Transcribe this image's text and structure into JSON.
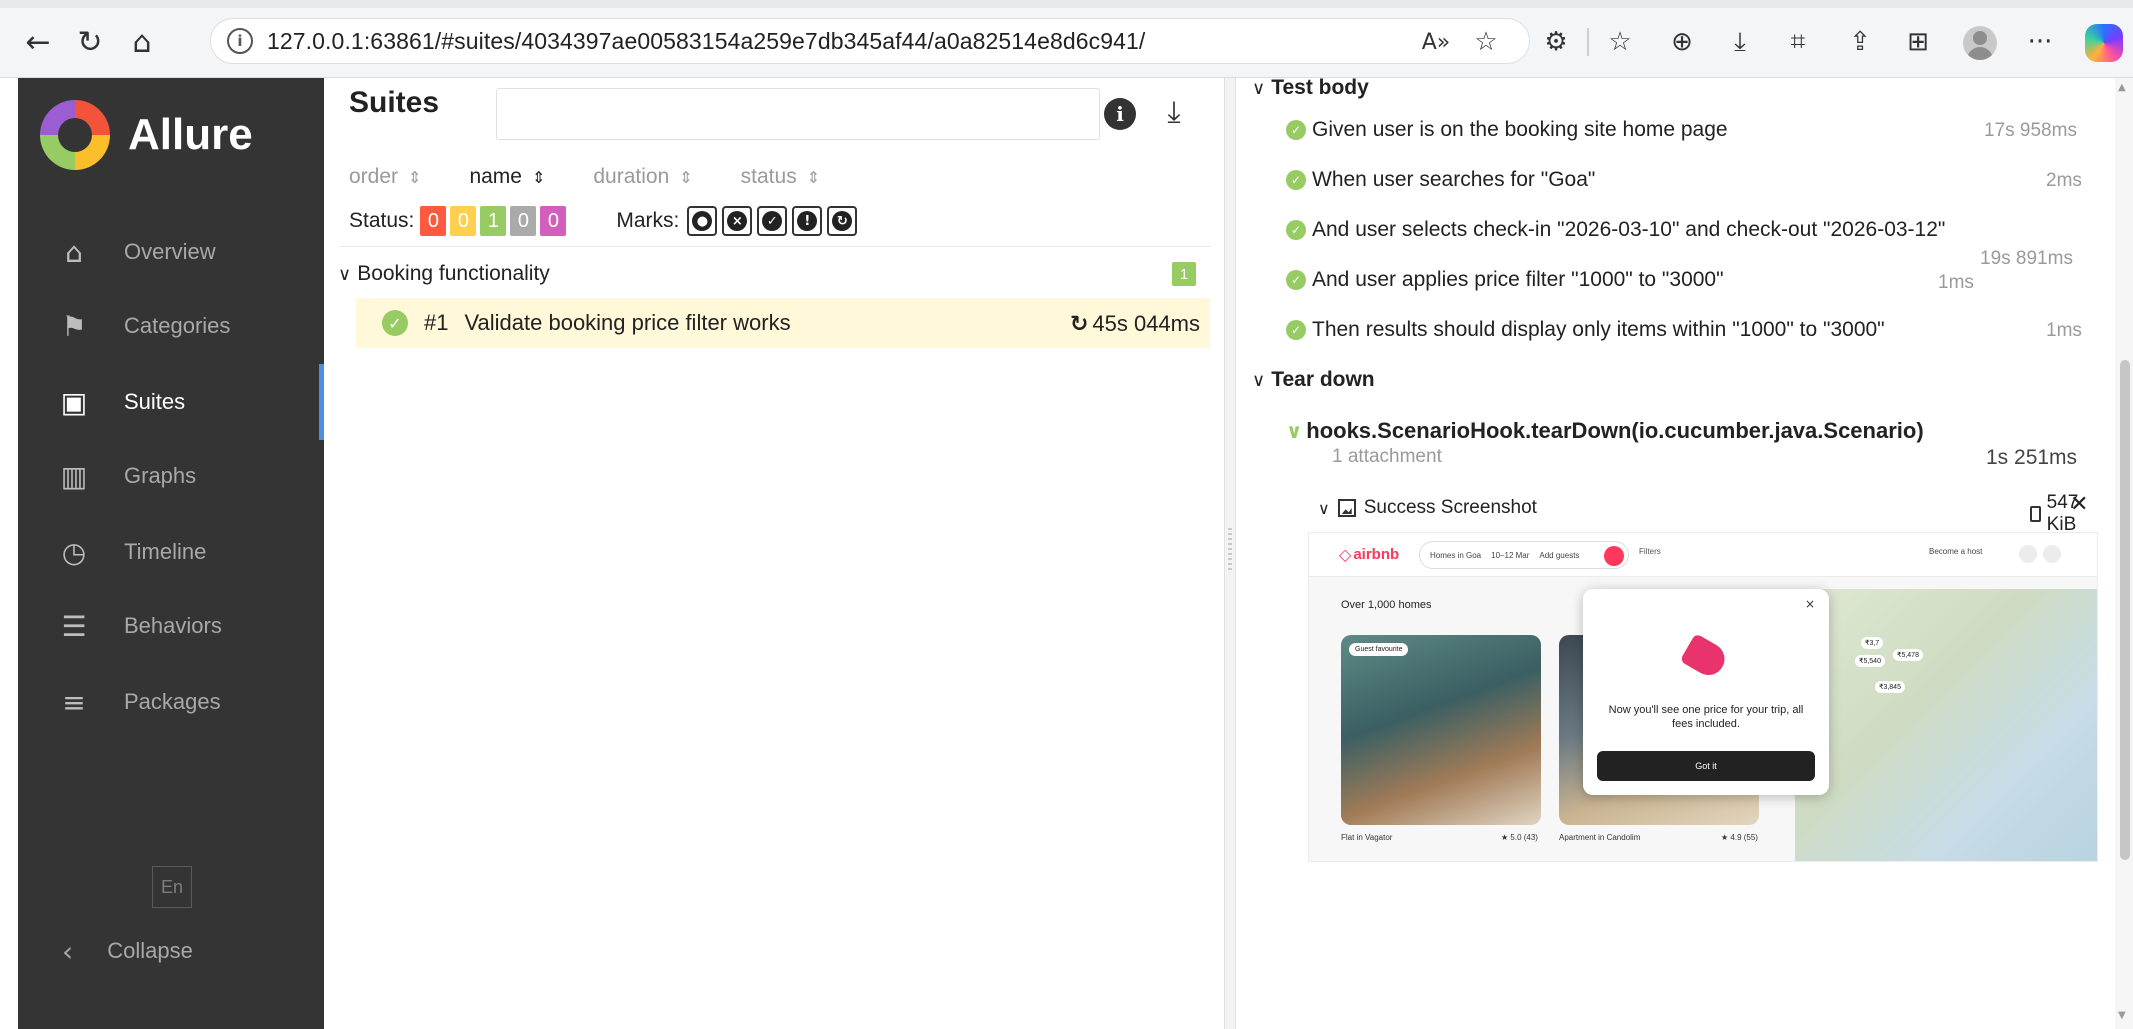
{
  "browser": {
    "back_icon": "←",
    "reload_icon": "↻",
    "home_icon": "⌂",
    "url": "127.0.0.1:63861/#suites/4034397ae00583154a259e7db345af44/a0a82514e8d6c941/",
    "read_aloud_icon": "A»",
    "favorite_icon": "☆",
    "toolbar_icons": [
      "extensions-icon",
      "favorites-icon",
      "collections-icon",
      "downloads-icon",
      "screenshot-icon",
      "share-icon",
      "workspaces-icon"
    ],
    "more_icon": "···"
  },
  "sidebar": {
    "brand": "Allure",
    "items": [
      {
        "label": "Overview",
        "icon": "home-icon"
      },
      {
        "label": "Categories",
        "icon": "flag-icon"
      },
      {
        "label": "Suites",
        "icon": "briefcase-icon"
      },
      {
        "label": "Graphs",
        "icon": "bar-chart-icon"
      },
      {
        "label": "Timeline",
        "icon": "clock-icon"
      },
      {
        "label": "Behaviors",
        "icon": "list-icon"
      },
      {
        "label": "Packages",
        "icon": "align-left-icon"
      }
    ],
    "active_item": "Suites",
    "language": "En",
    "collapse_label": "Collapse"
  },
  "suites": {
    "title": "Suites",
    "search_value": "",
    "sort": [
      {
        "label": "order",
        "active": false
      },
      {
        "label": "name",
        "active": true
      },
      {
        "label": "duration",
        "active": false
      },
      {
        "label": "status",
        "active": false
      }
    ],
    "status_label": "Status:",
    "status_counts": [
      {
        "value": "0",
        "color": "#fd5a3e"
      },
      {
        "value": "0",
        "color": "#ffd050"
      },
      {
        "value": "1",
        "color": "#97cc64"
      },
      {
        "value": "0",
        "color": "#aaaaaa"
      },
      {
        "value": "0",
        "color": "#d35ebe"
      }
    ],
    "marks_label": "Marks:",
    "marks": [
      "flaky-icon",
      "new-failed-icon",
      "new-passed-icon",
      "new-broken-icon",
      "retries-icon"
    ],
    "group": {
      "name": "Booking functionality",
      "count": "1"
    },
    "test": {
      "number": "#1",
      "name": "Validate booking price filter works",
      "duration": "45s 044ms"
    }
  },
  "details": {
    "test_body_label": "Test body",
    "steps": [
      {
        "text": "Given user is on the booking site home page",
        "duration": "17s 958ms"
      },
      {
        "text": "When user searches for \"Goa\"",
        "duration": "2ms"
      },
      {
        "text": "And user selects check-in \"2026-03-10\" and check-out \"2026-03-12\"",
        "duration": "19s 891ms"
      },
      {
        "text": "And user applies price filter \"1000\" to \"3000\"",
        "duration": "1ms"
      },
      {
        "text": "Then results should display only items within \"1000\" to \"3000\"",
        "duration": "1ms"
      }
    ],
    "tear_down_label": "Tear down",
    "hook": {
      "name": "hooks.ScenarioHook.tearDown(io.cucumber.java.Scenario)",
      "attachments": "1 attachment",
      "duration": "1s 251ms"
    },
    "attachment": {
      "name": "Success Screenshot",
      "size": "547 KiB"
    }
  },
  "screenshot": {
    "logo": "airbnb",
    "search_items": [
      "Homes in Goa",
      "10–12 Mar",
      "Add guests"
    ],
    "filters": "Filters",
    "host": "Become a host",
    "count": "Over 1,000 homes",
    "badge": "Guest favourite",
    "cards": [
      {
        "name": "Flat in Vagator",
        "rating": "★ 5.0 (43)"
      },
      {
        "name": "Apartment in Candolim",
        "rating": "★ 4.9 (55)"
      }
    ],
    "prices": [
      "₹3,7",
      "₹5,478",
      "₹5,540",
      "₹3,845"
    ],
    "modal_text": "Now you'll see one price for your trip, all fees included.",
    "modal_button": "Got it"
  }
}
